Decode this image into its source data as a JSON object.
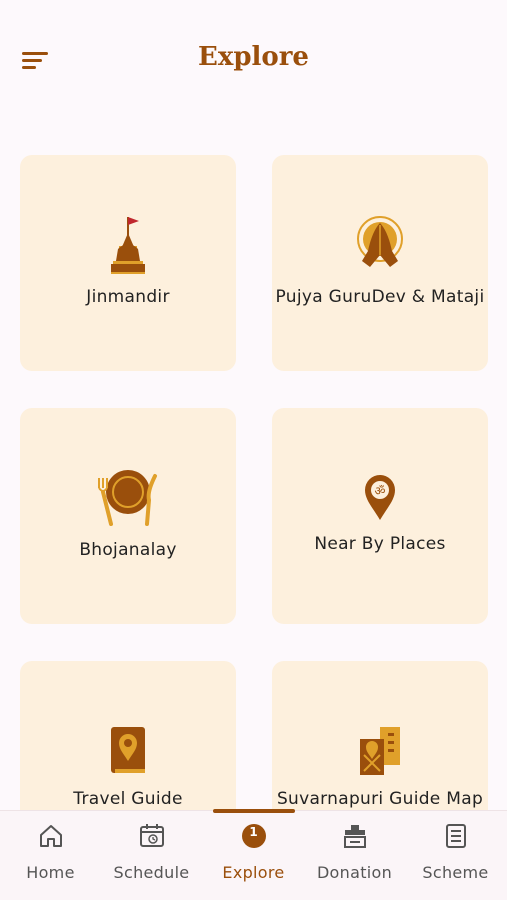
{
  "header": {
    "title": "Explore",
    "menu_icon": "menu-icon"
  },
  "cards": [
    {
      "label": "Jinmandir",
      "icon": "temple-icon"
    },
    {
      "label": "Pujya GuruDev & Mataji",
      "icon": "namaste-hands-icon"
    },
    {
      "label": "Bhojanalay",
      "icon": "plate-cutlery-icon"
    },
    {
      "label": "Near By Places",
      "icon": "om-location-pin-icon"
    },
    {
      "label": "Travel Guide",
      "icon": "guide-book-icon"
    },
    {
      "label": "Suvarnapuri Guide Map",
      "icon": "guide-map-icon"
    }
  ],
  "nav": {
    "items": [
      {
        "label": "Home",
        "icon": "home-icon"
      },
      {
        "label": "Schedule",
        "icon": "calendar-clock-icon"
      },
      {
        "label": "Explore",
        "icon": "explore-icon",
        "badge": "1",
        "active": true
      },
      {
        "label": "Donation",
        "icon": "donation-box-icon"
      },
      {
        "label": "Scheme",
        "icon": "scheme-list-icon"
      }
    ]
  },
  "colors": {
    "brand": "#9a4f0c",
    "card_bg": "#fdf0dd",
    "accent_gold": "#e0a02a",
    "flag_red": "#c0272d"
  }
}
